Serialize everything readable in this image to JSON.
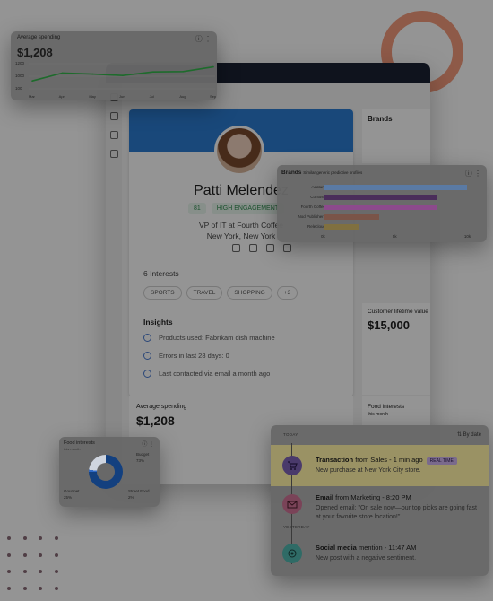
{
  "profile": {
    "name": "Patti Melendez",
    "engagement_pill": "HIGH ENGAGEMENT",
    "score_pill": "81",
    "job_title": "VP of IT at Fourth Coffee",
    "location": "New York, New York",
    "interests_header": "6 Interests",
    "interests": [
      "SPORTS",
      "TRAVEL",
      "SHOPPING",
      "+3"
    ],
    "insights_header": "Insights",
    "insights": [
      "Products used: Fabrikam dish machine",
      "Errors in last 28 days: 0",
      "Last contacted via email a month ago"
    ]
  },
  "avg_spending_main": {
    "title": "Average spending",
    "value": "$1,208"
  },
  "clv": {
    "title": "Customer lifetime value",
    "value": "$15,000"
  },
  "food_main": {
    "title": "Food interests",
    "subtitle": "this month"
  },
  "avg_spending_card": {
    "title": "Average spending",
    "value": "$1,208",
    "menu": "ⓘ  ⋮"
  },
  "brand_card": {
    "title": "Brands",
    "subtitle": "Similar generic predictive profiles",
    "menu": "ⓘ  ⋮"
  },
  "food_card": {
    "title": "Food interests",
    "subtitle": "this month",
    "labels": {
      "budget": "Budget",
      "budget_pct": "73%",
      "gourmet": "Gourmet",
      "gourmet_pct": "25%",
      "street": "Street Food",
      "street_pct": "2%"
    },
    "menu": "ⓘ  ⋮"
  },
  "timeline": {
    "day_today": "TODAY",
    "day_yesterday": "YESTERDAY",
    "sort": "By date",
    "items": [
      {
        "type": "Transaction",
        "source": "from Sales - 1 min ago",
        "badge": "REAL TIME",
        "body": "New purchase at New York City store."
      },
      {
        "type": "Email",
        "source": "from Marketing - 8:20 PM",
        "body": "Opened email: \"On sale now—our top picks are going fast at your favorite store location!\""
      },
      {
        "type": "Social media",
        "source": "mention - 11:47 AM",
        "body": "New post with a negative sentiment."
      }
    ]
  },
  "chart_data": [
    {
      "type": "line",
      "title": "Average spending",
      "categories": [
        "Mar",
        "Apr",
        "May",
        "Jun",
        "Jul",
        "Aug",
        "Sep"
      ],
      "series": [
        {
          "values": [
            1010,
            1120,
            1105,
            1085,
            1135,
            1140,
            1205
          ]
        }
      ],
      "yticks": [
        "1200",
        "1000",
        "100"
      ],
      "ylim": [
        900,
        1250
      ]
    },
    {
      "type": "bar",
      "title": "Brands",
      "categories": [
        "Adatum",
        "Contoso",
        "Fourth Coffee",
        "Nod Publishers",
        "Relecloud"
      ],
      "values": [
        15.5,
        12.3,
        12.3,
        6.0,
        3.8
      ],
      "xticks": [
        "0k",
        "5k",
        "10k"
      ],
      "xlim": [
        0,
        16
      ],
      "colors": [
        "#5a7aa4",
        "#4a2d5a",
        "#8c4a8c",
        "#7a5448",
        "#807040"
      ]
    },
    {
      "type": "pie",
      "title": "Food interests",
      "categories": [
        "Budget",
        "Gourmet",
        "Street Food"
      ],
      "values": [
        73,
        25,
        2
      ]
    }
  ]
}
